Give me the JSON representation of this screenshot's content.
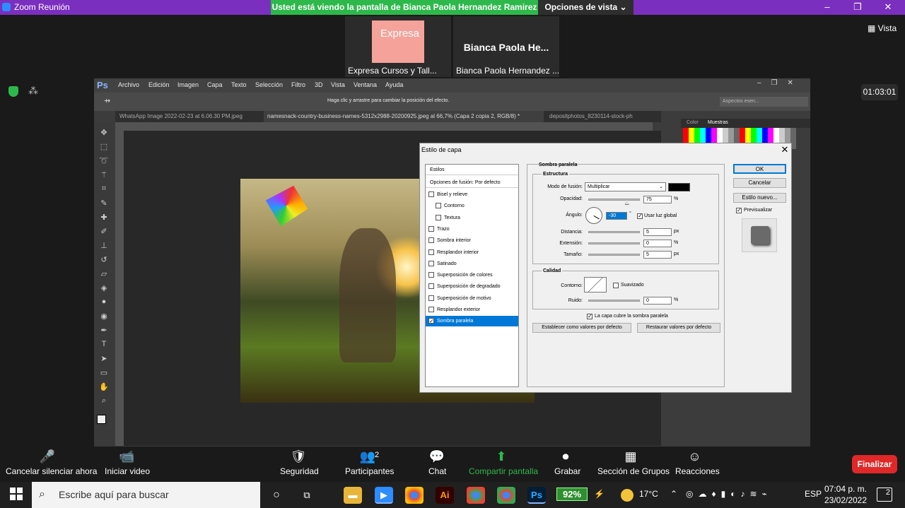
{
  "zoom": {
    "window_title": "Zoom Reunión",
    "share_banner": "Usted está viendo la pantalla de Bianca Paola Hernandez Ramirez",
    "view_options": "Opciones de vista",
    "view_caret": "⌄",
    "win_minimize": "–",
    "win_restore": "❐",
    "win_close": "✕",
    "view_label": "Vista",
    "timer": "01:03:01",
    "thumbnails": [
      {
        "image_text": "Expresa",
        "label": "Expresa Cursos y Tall..."
      },
      {
        "name": "Bianca Paola He...",
        "label": "Bianca Paola Hernandez ..."
      }
    ],
    "controls": [
      {
        "icon": "🎤",
        "label": "Cancelar silenciar ahora"
      },
      {
        "icon": "📹",
        "label": "Iniciar video"
      },
      {
        "icon": "🛡",
        "label": "Seguridad"
      },
      {
        "icon": "👥",
        "label": "Participantes",
        "count": "2"
      },
      {
        "icon": "💬",
        "label": "Chat"
      },
      {
        "icon": "⬆",
        "label": "Compartir pantalla"
      },
      {
        "icon": "⏺",
        "label": "Grabar"
      },
      {
        "icon": "▦",
        "label": "Sección de Grupos"
      },
      {
        "icon": "☺",
        "label": "Reacciones"
      }
    ],
    "end_button": "Finalizar",
    "accent_green": "#2eb84b",
    "end_red": "#e02828"
  },
  "photoshop": {
    "logo": "Ps",
    "menu": [
      "Archivo",
      "Edición",
      "Imagen",
      "Capa",
      "Texto",
      "Selección",
      "Filtro",
      "3D",
      "Vista",
      "Ventana",
      "Ayuda"
    ],
    "options_hint": "Haga clic y arrastre para cambiar la posición del efecto.",
    "workspace": "Aspectos esen...",
    "doc_tabs": [
      "WhatsApp Image 2022-02-23 at 6.06.30 PM.jpeg",
      "namesnack-country-business-names-5312x2988-20200925.jpeg al 66,7% (Capa 2 copia 2, RGB/8) *",
      "depositphotos_8230114-stock-ph"
    ],
    "panel_tabs": [
      "Color",
      "Muestras"
    ]
  },
  "dialog": {
    "title": "Estilo de capa",
    "styles_header": "Estilos",
    "blend_options": "Opciones de fusión: Por defecto",
    "styles": [
      {
        "label": "Bisel y relieve",
        "checked": false,
        "sub": false
      },
      {
        "label": "Contorno",
        "checked": false,
        "sub": true
      },
      {
        "label": "Textura",
        "checked": false,
        "sub": true
      },
      {
        "label": "Trazo",
        "checked": false,
        "sub": false
      },
      {
        "label": "Sombra interior",
        "checked": false,
        "sub": false
      },
      {
        "label": "Resplandor interior",
        "checked": false,
        "sub": false
      },
      {
        "label": "Satinado",
        "checked": false,
        "sub": false
      },
      {
        "label": "Superposición de colores",
        "checked": false,
        "sub": false
      },
      {
        "label": "Superposición de degradado",
        "checked": false,
        "sub": false
      },
      {
        "label": "Superposición de motivo",
        "checked": false,
        "sub": false
      },
      {
        "label": "Resplandor exterior",
        "checked": false,
        "sub": false
      },
      {
        "label": "Sombra paralela",
        "checked": true,
        "sub": false
      }
    ],
    "section_title": "Sombra paralela",
    "structure": {
      "title": "Estructura",
      "blend_mode_label": "Modo de fusión:",
      "blend_mode_value": "Multiplicar",
      "shadow_color": "#000000",
      "opacity_label": "Opacidad:",
      "opacity_value": "75",
      "opacity_unit": "%",
      "opacity_fraction": 0.75,
      "angle_label": "Ángulo:",
      "angle_value": "-30",
      "angle_unit": "°",
      "global_light_label": "Usar luz global",
      "global_light_checked": true,
      "distance_label": "Distancia:",
      "distance_value": "5",
      "distance_unit": "px",
      "spread_label": "Extensión:",
      "spread_value": "0",
      "spread_unit": "%",
      "size_label": "Tamaño:",
      "size_value": "5",
      "size_unit": "px"
    },
    "quality": {
      "title": "Calidad",
      "contour_label": "Contorno:",
      "antialias_label": "Suavizado",
      "noise_label": "Ruido:",
      "noise_value": "0",
      "noise_unit": "%"
    },
    "knockout_label": "La capa cubre la sombra paralela",
    "set_default": "Establecer como valores por defecto",
    "reset_default": "Restaurar valores por defecto",
    "ok": "OK",
    "cancel": "Cancelar",
    "new_style": "Estilo nuevo...",
    "preview_label": "Previsualizar"
  },
  "taskbar": {
    "search_placeholder": "Escribe aquí para buscar",
    "battery": "92%",
    "temperature": "17°C",
    "language": "ESP",
    "time": "07:04 p. m.",
    "date": "23/02/2022",
    "notifications": "2"
  }
}
